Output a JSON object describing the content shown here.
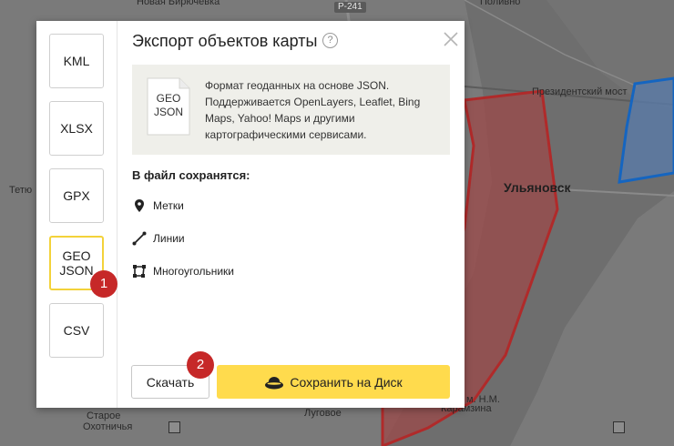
{
  "map": {
    "labels": {
      "top_village": "Новая Бирючевка",
      "road_number": "Р-241",
      "polivno": "Поливно",
      "tetyushi": "Тетю",
      "prezidentsky_most": "Президентский мост",
      "city": "Ульяновск",
      "staroe": "Старое",
      "okhotnichya": "Охотничья",
      "lugovoe": "Луговое",
      "karamzina": "Карамзина",
      "imeni": "м. Н.М."
    },
    "colors": {
      "polygon_red": "#b02a2a",
      "polygon_blue": "#1565c0"
    }
  },
  "dialog": {
    "title": "Экспорт объектов карты",
    "help_glyph": "?",
    "formats": [
      {
        "label": "KML"
      },
      {
        "label": "XLSX"
      },
      {
        "label": "GPX"
      },
      {
        "label": "GEO\nJSON",
        "active": true
      },
      {
        "label": "CSV"
      }
    ],
    "info": {
      "file_icon_label": "GEO\nJSON",
      "description": "Формат геоданных на основе JSON. Поддерживается OpenLayers, Leaflet, Bing Maps, Yahoo! Maps и другими картографическими сервисами."
    },
    "saves_heading": "В файл сохранятся:",
    "features": [
      {
        "label": "Метки",
        "icon": "placemark-icon"
      },
      {
        "label": "Линии",
        "icon": "line-icon"
      },
      {
        "label": "Многоугольники",
        "icon": "polygon-icon"
      }
    ],
    "download_label": "Скачать",
    "save_to_disk_label": "Сохранить на Диск",
    "accent_color": "#ffdb4d",
    "active_border_color": "#f3d23a"
  },
  "badges": {
    "step1": "1",
    "step2": "2"
  }
}
